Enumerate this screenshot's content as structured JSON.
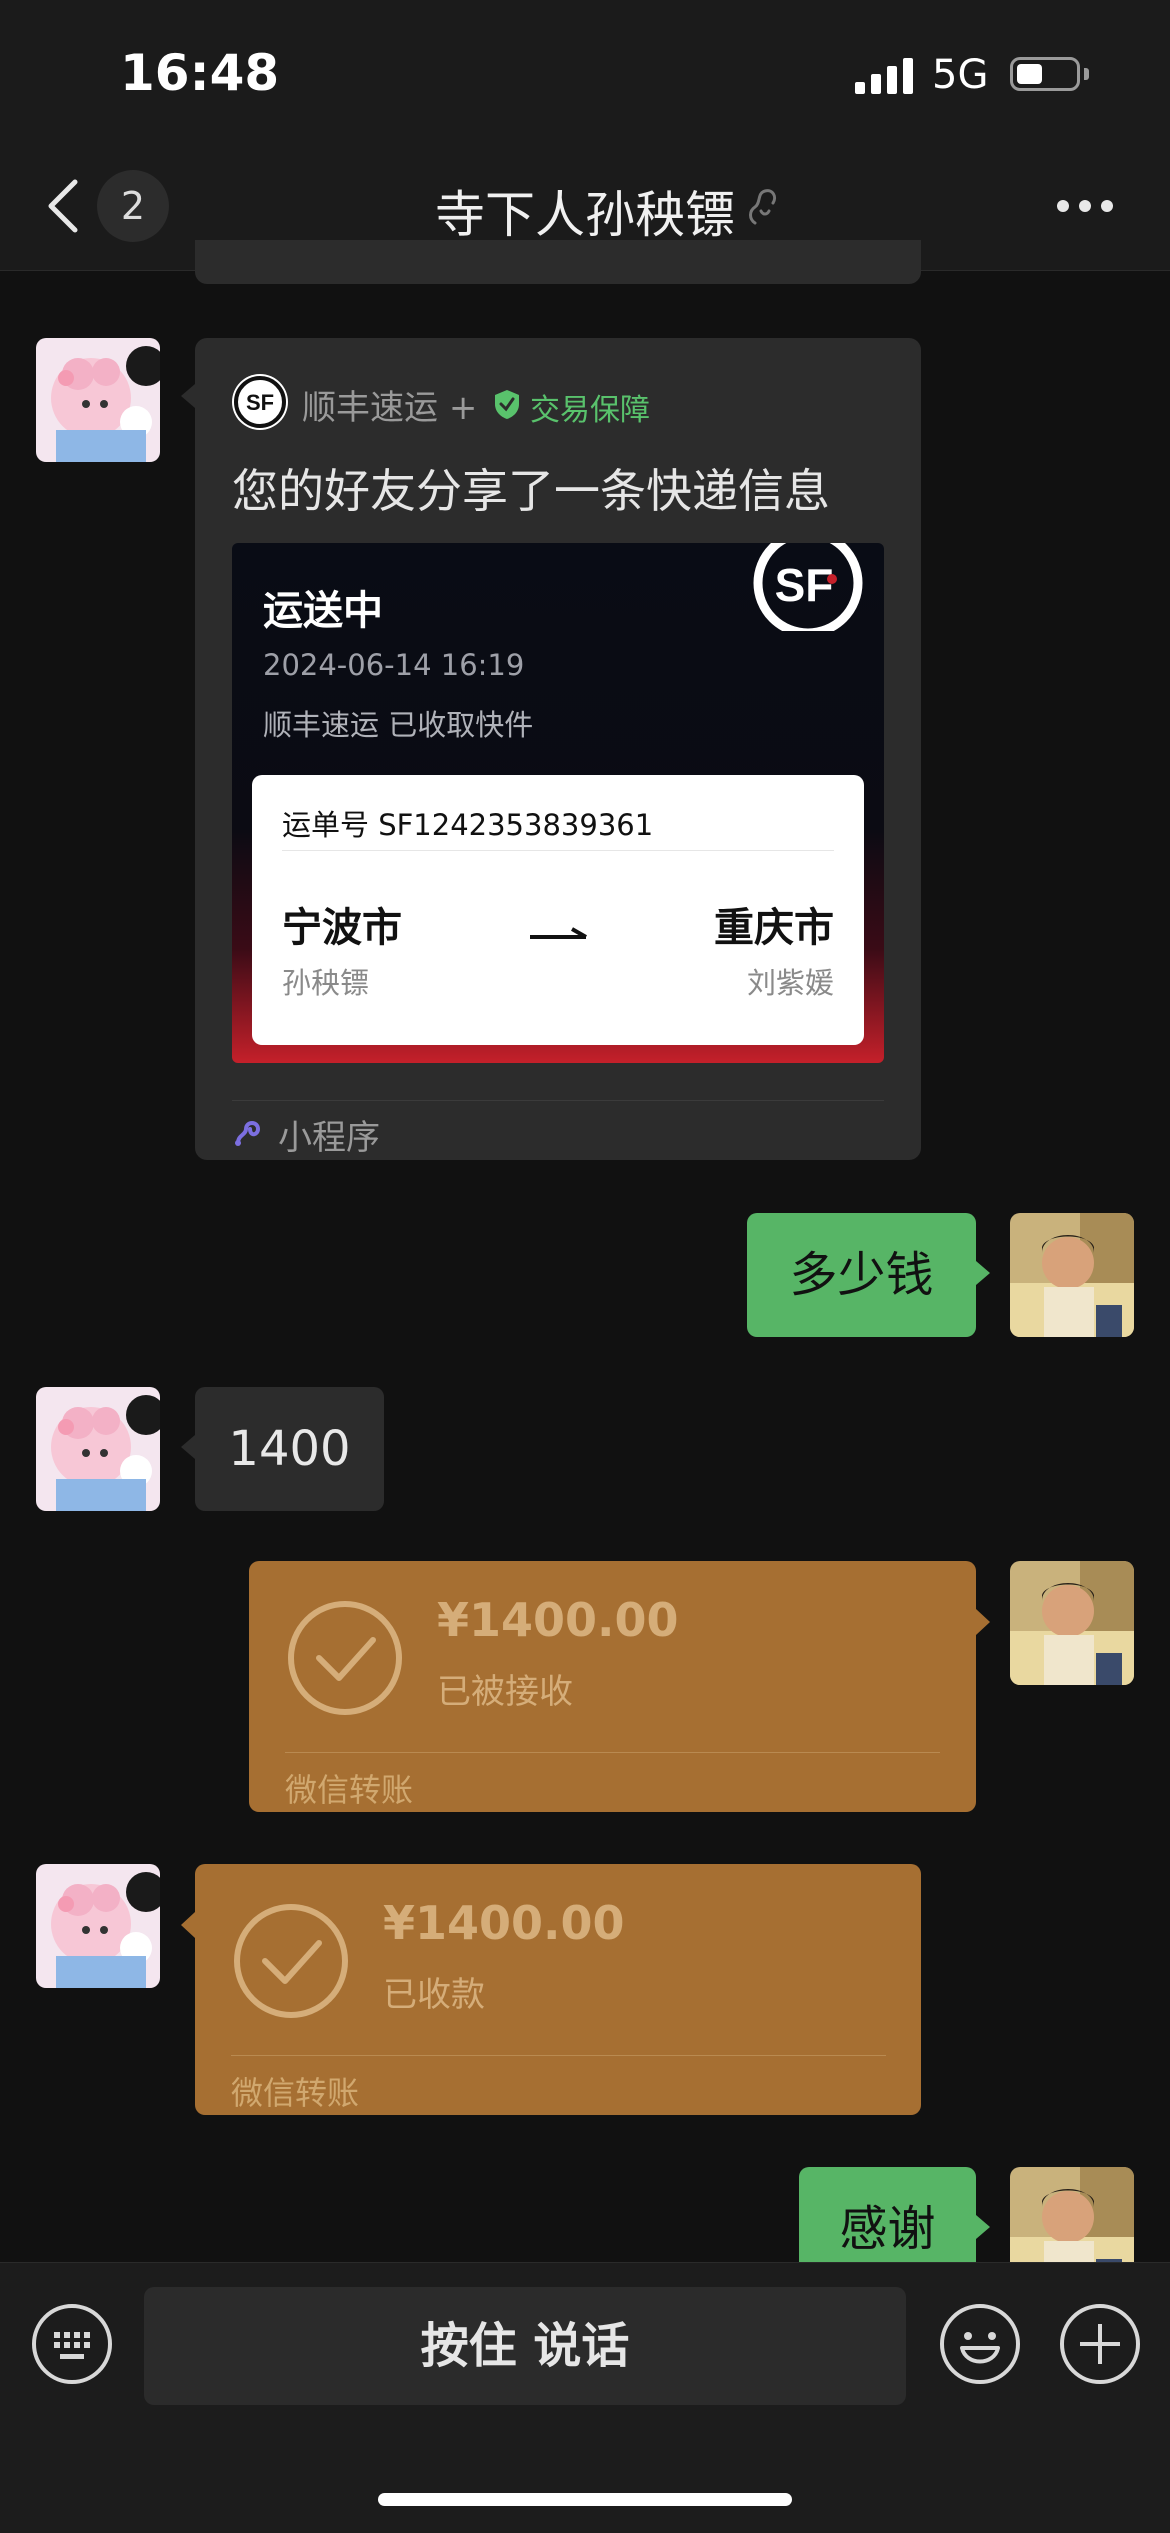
{
  "status_bar": {
    "time": "16:48",
    "network": "5G",
    "battery_level": 0.4
  },
  "nav": {
    "unread_count": "2",
    "title": "寺下人孙秧镖"
  },
  "messages": {
    "express_card": {
      "brand": "顺丰速运",
      "brand_suffix": "+",
      "guarantee": "交易保障",
      "title": "您的好友分享了一条快递信息",
      "status": "运送中",
      "timestamp": "2024-06-14 16:19",
      "event": "顺丰速运 已收取快件",
      "waybill": "运单号 SF1242353839361",
      "from_city": "宁波市",
      "from_name": "孙秧镖",
      "to_city": "重庆市",
      "to_name": "刘紫媛",
      "footer": "小程序",
      "logo_text": "SF"
    },
    "outgoing_1": "多少钱",
    "incoming_1": "1400",
    "transfer_sent": {
      "amount": "¥1400.00",
      "status": "已被接收",
      "footer": "微信转账"
    },
    "transfer_received": {
      "amount": "¥1400.00",
      "status": "已收款",
      "footer": "微信转账"
    },
    "outgoing_2": "感谢"
  },
  "input_bar": {
    "voice_label": "按住 说话"
  },
  "colors": {
    "green_bubble": "#57b566",
    "transfer": "#a66f32",
    "background": "#111111",
    "accent_red": "#c5202a"
  },
  "icons": [
    "back-icon",
    "mute-icon",
    "more-icon",
    "shield-check-icon",
    "mini-program-icon",
    "check-circle-icon",
    "keyboard-icon",
    "emoji-icon",
    "plus-icon"
  ]
}
